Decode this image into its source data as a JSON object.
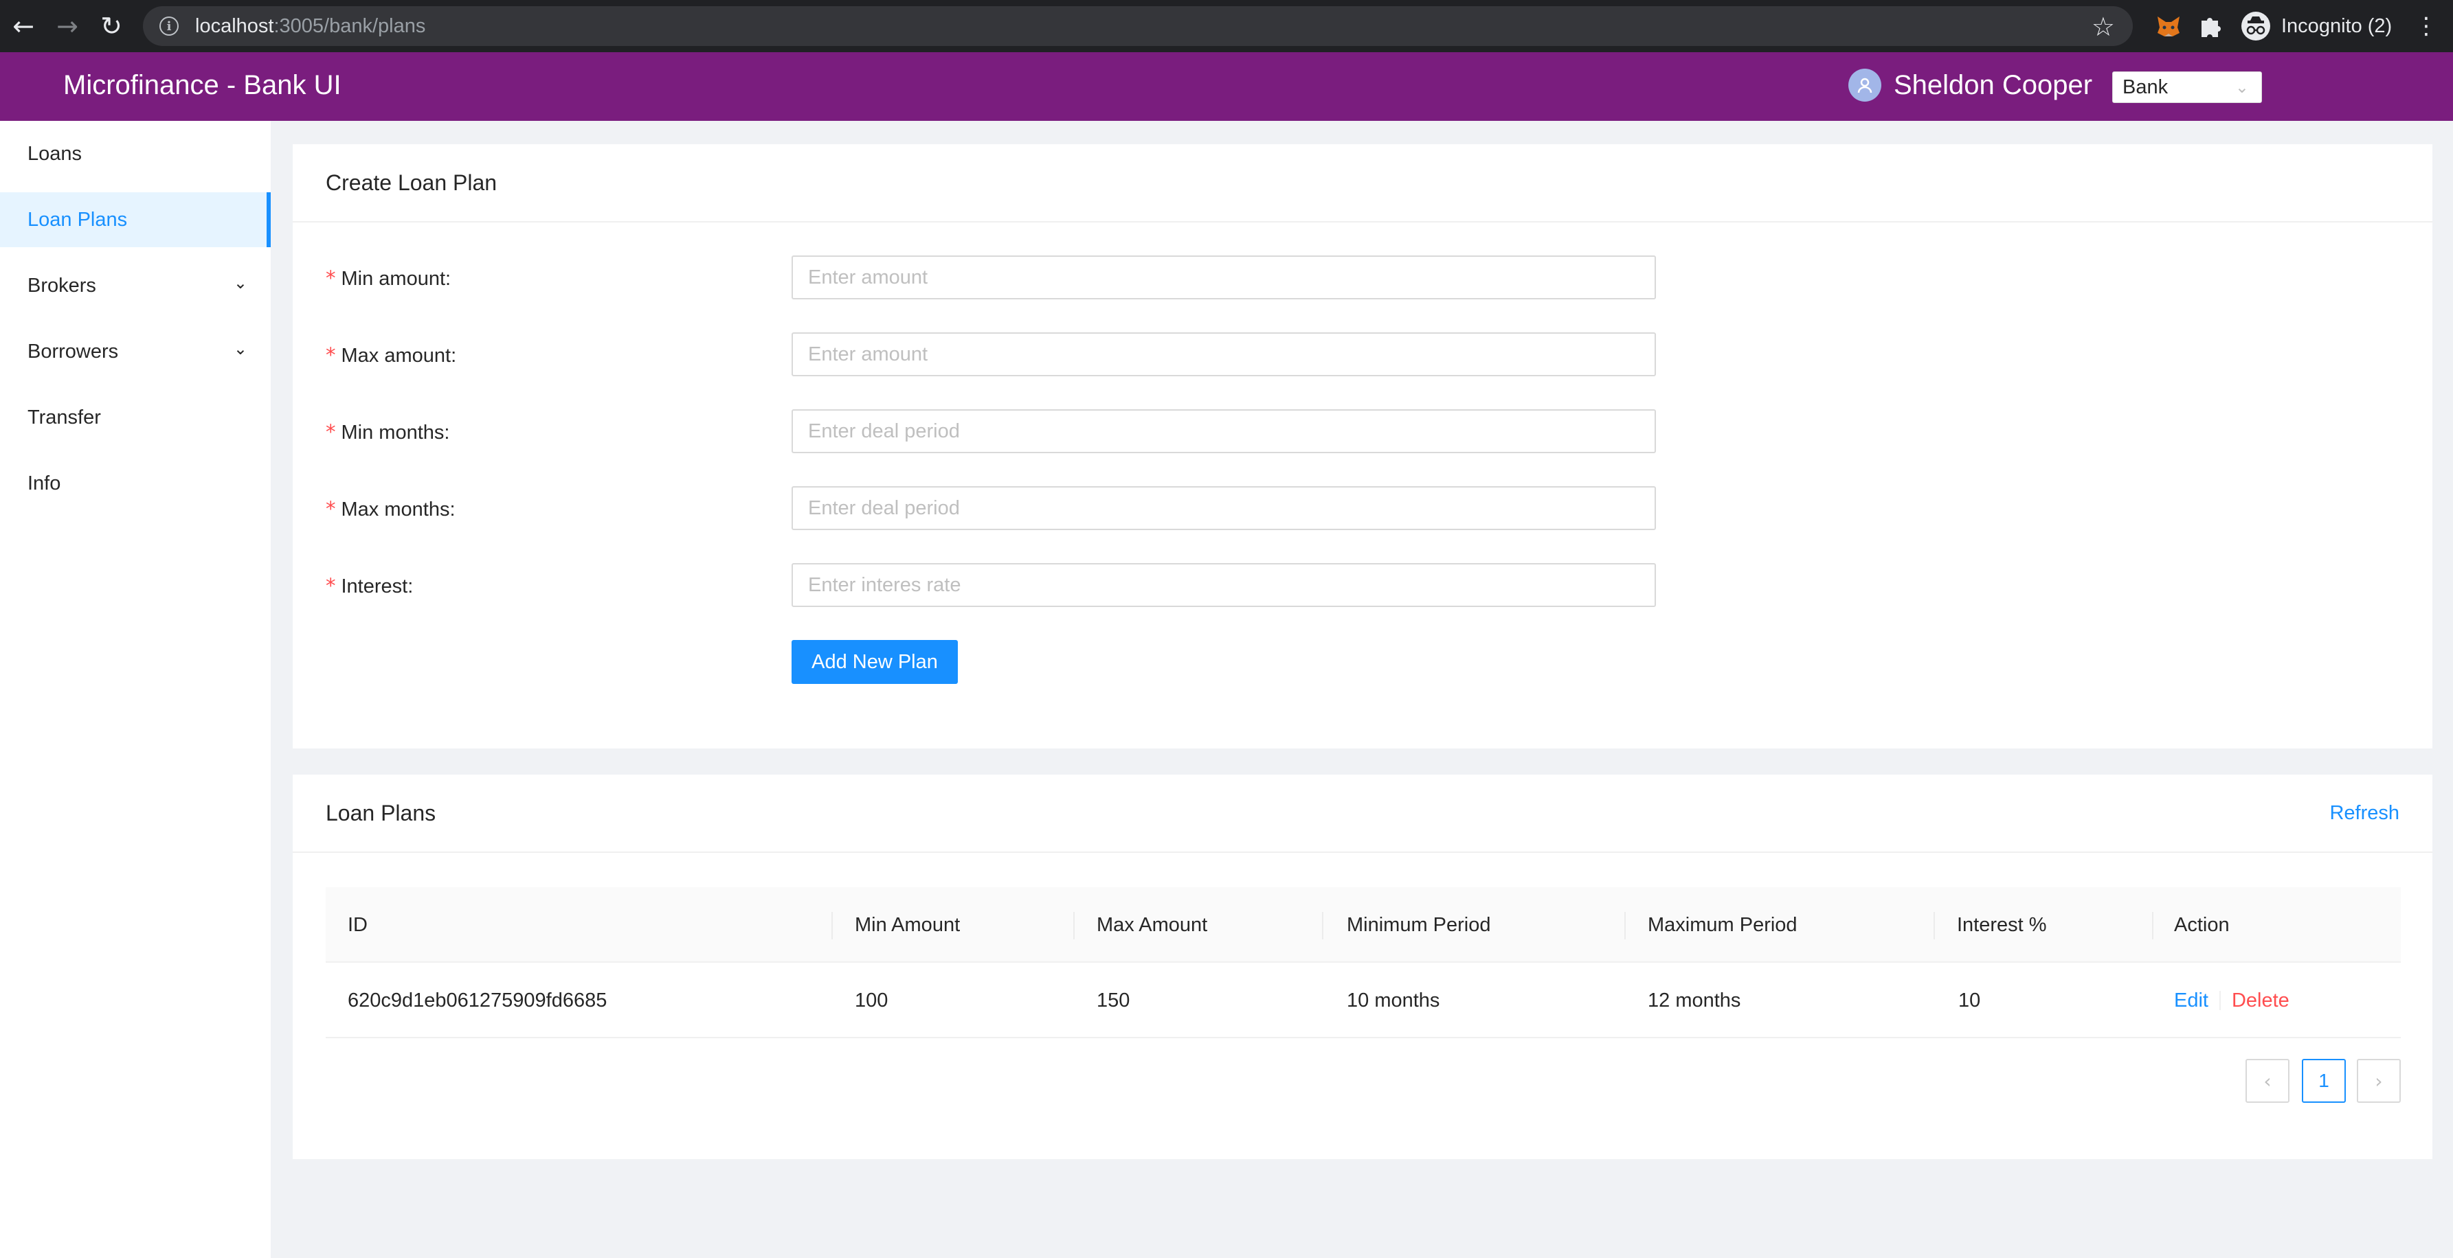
{
  "browser": {
    "url_host": "localhost",
    "url_path": ":3005/bank/plans",
    "profile_label": "Incognito (2)",
    "icons": [
      "back-arrow",
      "forward-arrow",
      "reload",
      "site-info",
      "bookmark-star",
      "metamask-extension",
      "extensions-puzzle",
      "incognito",
      "menu-kebab"
    ]
  },
  "header": {
    "title": "Microfinance - Bank UI",
    "user_name": "Sheldon Cooper",
    "role_select": "Bank",
    "background_color": "#7a1d7e"
  },
  "sidebar": {
    "items": [
      {
        "label": "Loans",
        "active": false
      },
      {
        "label": "Loan Plans",
        "active": true
      },
      {
        "label": "Brokers",
        "active": false,
        "expandable": true
      },
      {
        "label": "Borrowers",
        "active": false,
        "expandable": true
      },
      {
        "label": "Transfer",
        "active": false
      },
      {
        "label": "Info",
        "active": false
      }
    ],
    "active_color": "#1890ff"
  },
  "create_form": {
    "title": "Create Loan Plan",
    "fields": [
      {
        "label": "Min amount",
        "placeholder": "Enter amount",
        "value": "",
        "required": true
      },
      {
        "label": "Max amount",
        "placeholder": "Enter amount",
        "value": "",
        "required": true
      },
      {
        "label": "Min months",
        "placeholder": "Enter deal period",
        "value": "",
        "required": true
      },
      {
        "label": "Max months",
        "placeholder": "Enter deal period",
        "value": "",
        "required": true
      },
      {
        "label": "Interest",
        "placeholder": "Enter interes rate",
        "value": "",
        "required": true
      }
    ],
    "required_marker": "*",
    "label_suffix": ":",
    "submit_label": "Add New Plan"
  },
  "plans_table": {
    "title": "Loan Plans",
    "refresh_label": "Refresh",
    "columns": [
      "ID",
      "Min Amount",
      "Max Amount",
      "Minimum Period",
      "Maximum Period",
      "Interest %",
      "Action"
    ],
    "rows": [
      {
        "id": "620c9d1eb061275909fd6685",
        "min_amount": "100",
        "max_amount": "150",
        "min_period": "10 months",
        "max_period": "12 months",
        "interest": "10",
        "actions": {
          "edit": "Edit",
          "delete": "Delete"
        }
      }
    ],
    "pagination": {
      "current_page": "1",
      "prev_disabled": true,
      "next_disabled": true
    }
  }
}
